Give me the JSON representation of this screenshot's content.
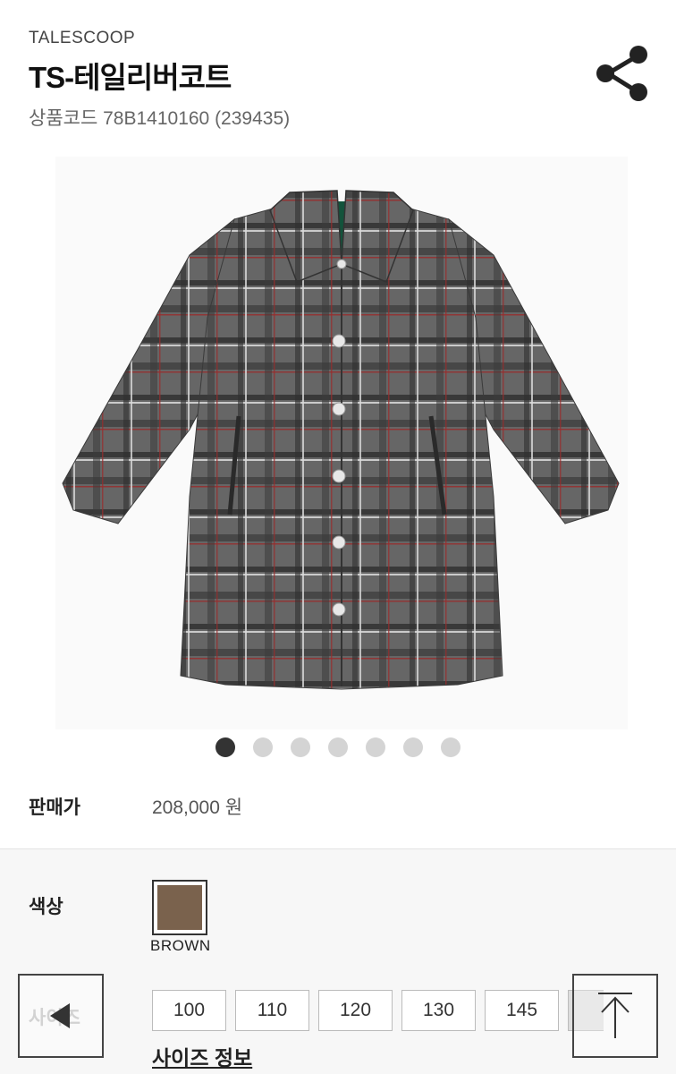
{
  "header": {
    "brand": "TALESCOOP",
    "title": "TS-테일리버코트",
    "product_code": "상품코드 78B1410160 (239435)"
  },
  "icons": {
    "share": "share-icon",
    "back": "back-arrow-icon",
    "top": "scroll-top-icon"
  },
  "gallery": {
    "image": "plaid-coat-product-photo",
    "dots_total": 7,
    "active_dot": 1
  },
  "price": {
    "label": "판매가",
    "value": "208,000  원"
  },
  "options": {
    "color_label": "색상",
    "color_name": "BROWN",
    "color_hex": "#7a624d",
    "size_label": "사이즈",
    "sizes": [
      "100",
      "110",
      "120",
      "130",
      "145"
    ],
    "size_info_link": "사이즈 정보"
  },
  "colors": {
    "coat_base": "#5e5e5e",
    "lining": "#13533b",
    "dot_active": "#333333",
    "dot_inactive": "#d4d4d4"
  }
}
